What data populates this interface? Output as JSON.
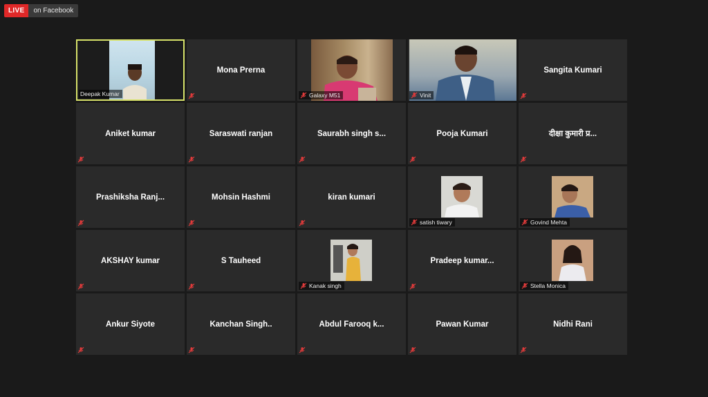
{
  "live": {
    "label": "LIVE",
    "platform": "on Facebook"
  },
  "colors": {
    "background": "#1a1a1a",
    "tile": "#2a2a2a",
    "active_border": "#d8e36a",
    "live_red": "#e02828",
    "muted_mic": "#e23b3b"
  },
  "participants": [
    {
      "name": "Deepak Kumar",
      "video": true,
      "active": true
    },
    {
      "name": "Mona Prerna",
      "video": false
    },
    {
      "name": "Galaxy M51",
      "video": true
    },
    {
      "name": "Vinit",
      "video": true
    },
    {
      "name": "Sangita Kumari",
      "video": false
    },
    {
      "name": "Aniket kumar",
      "video": false
    },
    {
      "name": "Saraswati ranjan",
      "video": false
    },
    {
      "name": "Saurabh  singh  s...",
      "video": false
    },
    {
      "name": "Pooja Kumari",
      "video": false
    },
    {
      "name": "दीक्षा कुमारी     प्र...",
      "video": false
    },
    {
      "name": "Prashiksha  Ranj...",
      "video": false
    },
    {
      "name": "Mohsin Hashmi",
      "video": false
    },
    {
      "name": "kiran kumari",
      "video": false
    },
    {
      "name": "satish tiwary",
      "video": false,
      "photo": true
    },
    {
      "name": "Govind Mehta",
      "video": false,
      "photo": true
    },
    {
      "name": "AKSHAY kumar",
      "video": false
    },
    {
      "name": "S Tauheed",
      "video": false
    },
    {
      "name": "Kanak singh",
      "video": false,
      "photo": true
    },
    {
      "name": "Pradeep  kumar...",
      "video": false
    },
    {
      "name": "Stella Monica",
      "video": false,
      "photo": true
    },
    {
      "name": "Ankur Siyote",
      "video": false
    },
    {
      "name": "Kanchan Singh..",
      "video": false
    },
    {
      "name": "Abdul  Farooq  k...",
      "video": false
    },
    {
      "name": "Pawan Kumar",
      "video": false
    },
    {
      "name": "Nidhi Rani",
      "video": false
    }
  ]
}
